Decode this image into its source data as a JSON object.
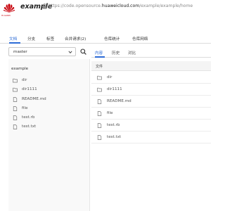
{
  "brand": {
    "logo_text": "HUAWEI",
    "logo_color": "#c7000b"
  },
  "header": {
    "title": "example",
    "url_prefix": "https://code.opensource.",
    "url_domain": "huaweicloud.com",
    "url_suffix": "/example/example/home"
  },
  "repo_tabs": [
    {
      "label": "文档",
      "active": true
    },
    {
      "label": "分支",
      "active": false
    },
    {
      "label": "标签",
      "active": false
    },
    {
      "label": "合并请求(2)",
      "active": false
    },
    {
      "label": "仓库统计",
      "active": false
    },
    {
      "label": "仓库网络",
      "active": false
    }
  ],
  "branch": {
    "value": "master"
  },
  "tree": {
    "root": "example",
    "items": [
      {
        "name": "dir",
        "icon": "folder-icon"
      },
      {
        "name": "dir1111",
        "icon": "folder-icon"
      },
      {
        "name": "README.md",
        "icon": "file-icon"
      },
      {
        "name": "file",
        "icon": "file-icon"
      },
      {
        "name": "test.rb",
        "icon": "file-icon"
      },
      {
        "name": "test.txt",
        "icon": "file-icon"
      }
    ]
  },
  "view_tabs": [
    {
      "label": "内容",
      "active": true
    },
    {
      "label": "历史",
      "active": false
    },
    {
      "label": "对比",
      "active": false
    }
  ],
  "file_list": {
    "header": "文件",
    "rows": [
      {
        "name": "dir",
        "icon": "folder-icon"
      },
      {
        "name": "dir1111",
        "icon": "folder-icon"
      },
      {
        "name": "README.md",
        "icon": "file-icon"
      },
      {
        "name": "file",
        "icon": "file-icon"
      },
      {
        "name": "test.rb",
        "icon": "file-icon"
      },
      {
        "name": "test.txt",
        "icon": "file-icon"
      }
    ]
  },
  "colors": {
    "accent": "#2c6bd6",
    "icon_gray": "#666666"
  }
}
